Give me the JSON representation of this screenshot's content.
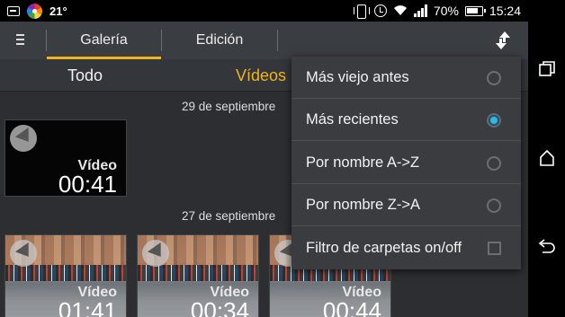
{
  "status_bar": {
    "temperature": "21°",
    "battery": "70%",
    "time": "15:24",
    "icons": [
      "sms-icon",
      "flower-app-icon",
      "vibrate-icon",
      "alarm-icon",
      "wifi-icon",
      "signal-icon",
      "battery-icon"
    ]
  },
  "toolbar": {
    "menu_icon": "≡",
    "tabs": [
      {
        "label": "Galería",
        "active": true
      },
      {
        "label": "Edición",
        "active": false
      }
    ],
    "sort_icon": "sort-icon"
  },
  "subtabs": [
    {
      "label": "Todo",
      "active": false
    },
    {
      "label": "Vídeos",
      "active": true
    }
  ],
  "groups": [
    {
      "date": "29 de septiembre",
      "items": [
        {
          "label": "Vídeo",
          "duration": "00:41"
        }
      ]
    },
    {
      "date": "27 de septiembre",
      "items": [
        {
          "label": "Vídeo",
          "duration": "01:41"
        },
        {
          "label": "Vídeo",
          "duration": "00:34"
        },
        {
          "label": "Vídeo",
          "duration": "00:44"
        }
      ]
    }
  ],
  "sort_menu": {
    "items": [
      {
        "label": "Más viejo antes",
        "type": "radio",
        "selected": false
      },
      {
        "label": "Más recientes",
        "type": "radio",
        "selected": true
      },
      {
        "label": "Por nombre A->Z",
        "type": "radio",
        "selected": false
      },
      {
        "label": "Por nombre Z->A",
        "type": "radio",
        "selected": false
      },
      {
        "label": "Filtro de carpetas on/off",
        "type": "checkbox",
        "selected": false
      }
    ]
  },
  "colors": {
    "accent": "#f0b41c",
    "radio_selected": "#33b5e5",
    "toolbar_bg": "#3a3d42",
    "menu_bg": "#3a3c40"
  },
  "nav_bar": [
    "recent-apps-icon",
    "home-icon",
    "back-icon"
  ]
}
